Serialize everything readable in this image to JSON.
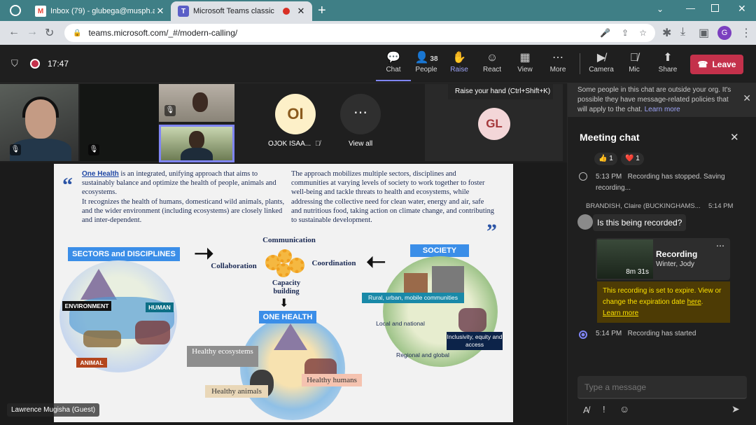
{
  "browser": {
    "tabs": [
      {
        "title": "Inbox (79) - glubega@musph.ac",
        "icon": "gmail-icon"
      },
      {
        "title": "Microsoft Teams classic",
        "icon": "teams-icon"
      }
    ],
    "url": "teams.microsoft.com/_#/modern-calling/",
    "profile_initial": "G"
  },
  "meeting": {
    "time": "17:47",
    "toolbar": [
      {
        "label": "Chat",
        "icon": "chat-icon"
      },
      {
        "label": "People",
        "icon": "people-icon",
        "count": "38"
      },
      {
        "label": "Raise",
        "icon": "raise-hand-icon"
      },
      {
        "label": "React",
        "icon": "react-icon"
      },
      {
        "label": "View",
        "icon": "view-icon"
      },
      {
        "label": "More",
        "icon": "more-icon"
      },
      {
        "label": "Camera",
        "icon": "camera-off-icon"
      },
      {
        "label": "Mic",
        "icon": "mic-off-icon"
      },
      {
        "label": "Share",
        "icon": "share-icon"
      }
    ],
    "leave_label": "Leave",
    "tooltip": "Raise your hand (Ctrl+Shift+K)",
    "participants": {
      "oi_initials": "OI",
      "oi_name": "OJOK ISAA...",
      "view_all": "View all",
      "gl_initials": "GL"
    },
    "presenter_label": "Lawrence Mugisha (Guest)"
  },
  "slide": {
    "left_para_bold": "One Health",
    "left_para": " is an integrated, unifying approach that aims to sustainably balance and optimize the health of people, animals and ecosystems.",
    "left_para2": "It recognizes the health of humans, domesticand wild animals, plants, and the wider environment (including ecosystems) are closely linked and inter-dependent.",
    "right_para": "The approach mobilizes multiple sectors, disciplines and communities at varying levels of society to work together to foster well-being and tackle threats to health and ecosystems, while addressing the collective need for clean water, energy and air, safe and nutritious food, taking action on climate change, and contributing to sustainable development.",
    "sectors": "SECTORS and DISCIPLINES",
    "environment": "ENVIRONMENT",
    "human": "HUMAN",
    "animal": "ANIMAL",
    "communication": "Communication",
    "collaboration": "Collaboration",
    "coordination": "Coordination",
    "capacity": "Capacity building",
    "one_health": "ONE HEALTH",
    "healthy_ecosystems": "Healthy ecosystems",
    "healthy_animals": "Healthy animals",
    "healthy_humans": "Healthy humans",
    "society": "SOCIETY",
    "rural": "Rural, urban, mobile communities",
    "local": "Local and national",
    "regional": "Regional and global",
    "inclusivity": "Inclusivity, equity and access"
  },
  "chat": {
    "banner": "Some people in this chat are outside your org. It's possible they have message-related policies that will apply to the chat.",
    "banner_link": "Learn more",
    "title": "Meeting chat",
    "reactions": [
      {
        "emoji": "👍",
        "count": "1"
      },
      {
        "emoji": "❤️",
        "count": "1"
      }
    ],
    "event1_time": "5:13 PM",
    "event1_text": "Recording has stopped. Saving recording...",
    "sender": "BRANDISH, Claire (BUCKINGHAMS...",
    "sender_time": "5:14 PM",
    "message": "Is this being recorded?",
    "recording_title": "Recording",
    "recording_author": "Winter, Jody",
    "recording_duration": "8m 31s",
    "expire_text": "This recording is set to expire. View or change the expiration date ",
    "expire_link": "here",
    "expire_learn": "Learn more",
    "event2_time": "5:14 PM",
    "event2_text": "Recording has started",
    "input_placeholder": "Type a message"
  }
}
